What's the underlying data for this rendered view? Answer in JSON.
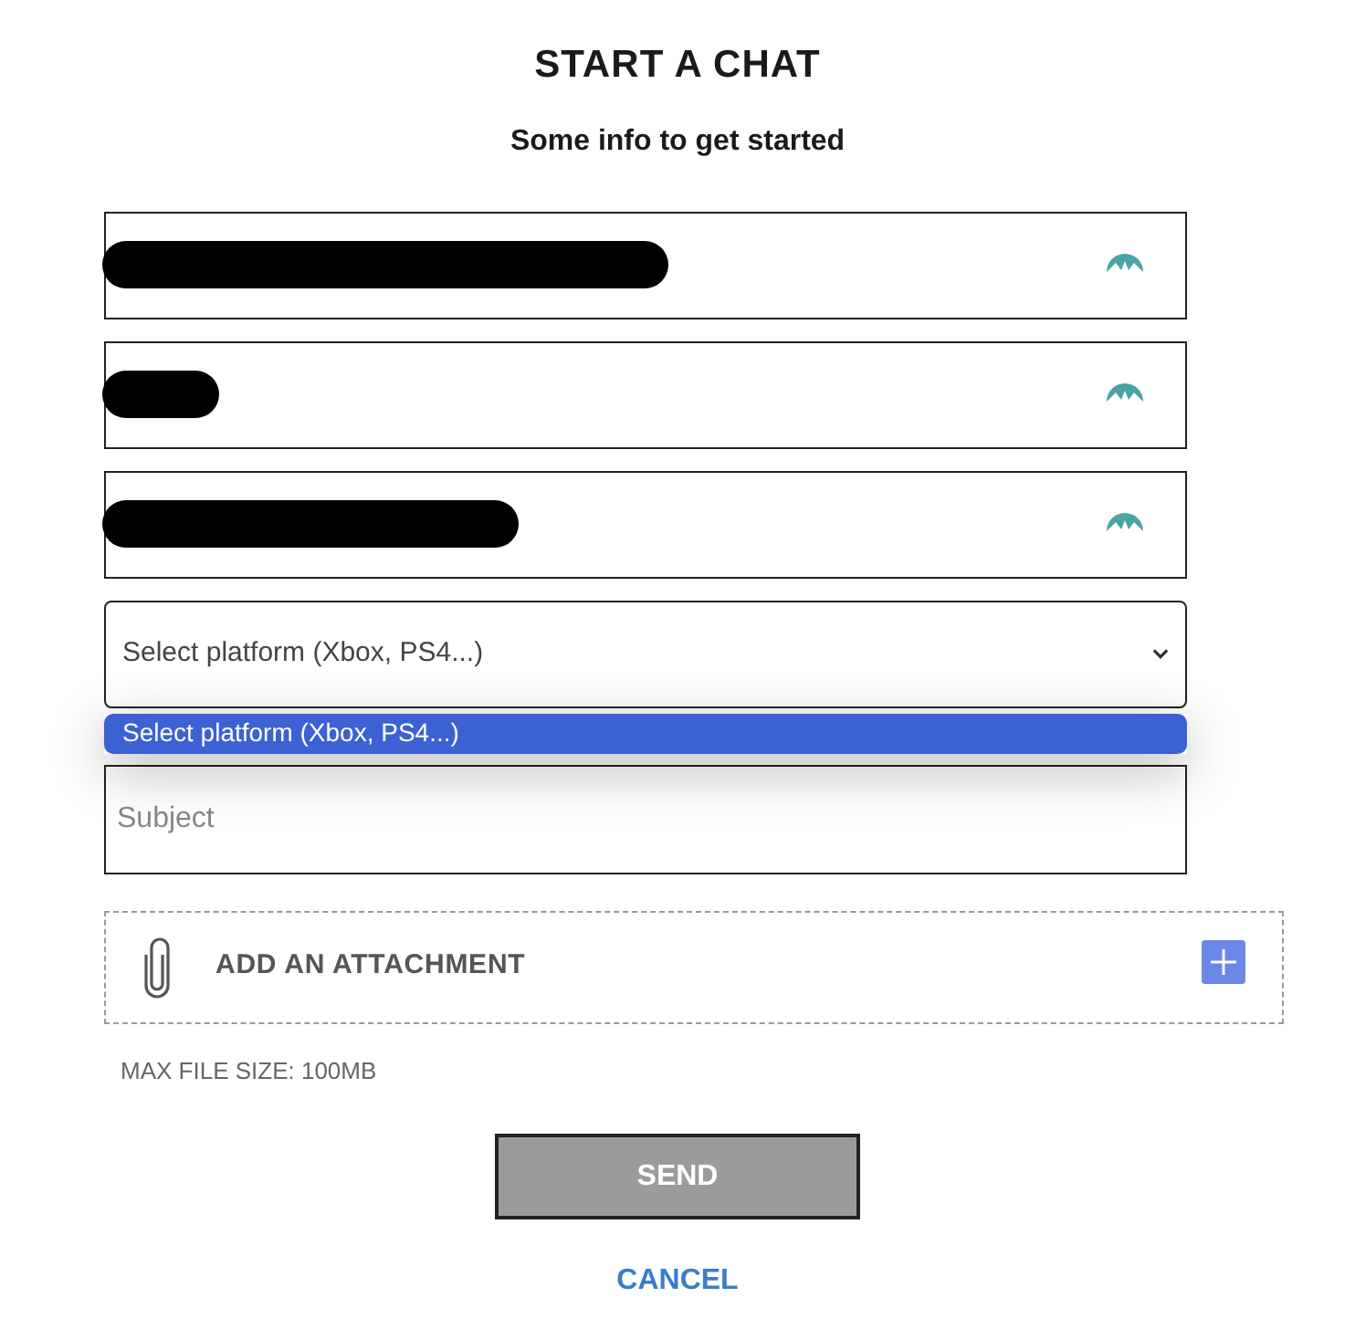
{
  "title": "START A CHAT",
  "subtitle": "Some info to get started",
  "fields": [
    {
      "redacted": true,
      "kind": "long"
    },
    {
      "redacted": true,
      "kind": "short"
    },
    {
      "redacted": true,
      "kind": "medium"
    }
  ],
  "platform_select": {
    "value": "Select platform (Xbox, PS4...)",
    "expanded": true,
    "options": [
      {
        "label": "Select platform (Xbox, PS4...)",
        "selected": true
      }
    ]
  },
  "subject": {
    "placeholder": "Subject"
  },
  "attachment": {
    "label": "ADD AN ATTACHMENT"
  },
  "max_file_size": "MAX FILE SIZE: 100MB",
  "buttons": [
    {
      "kind": "primary",
      "label": "SEND"
    },
    {
      "kind": "link",
      "label": "CANCEL"
    }
  ]
}
